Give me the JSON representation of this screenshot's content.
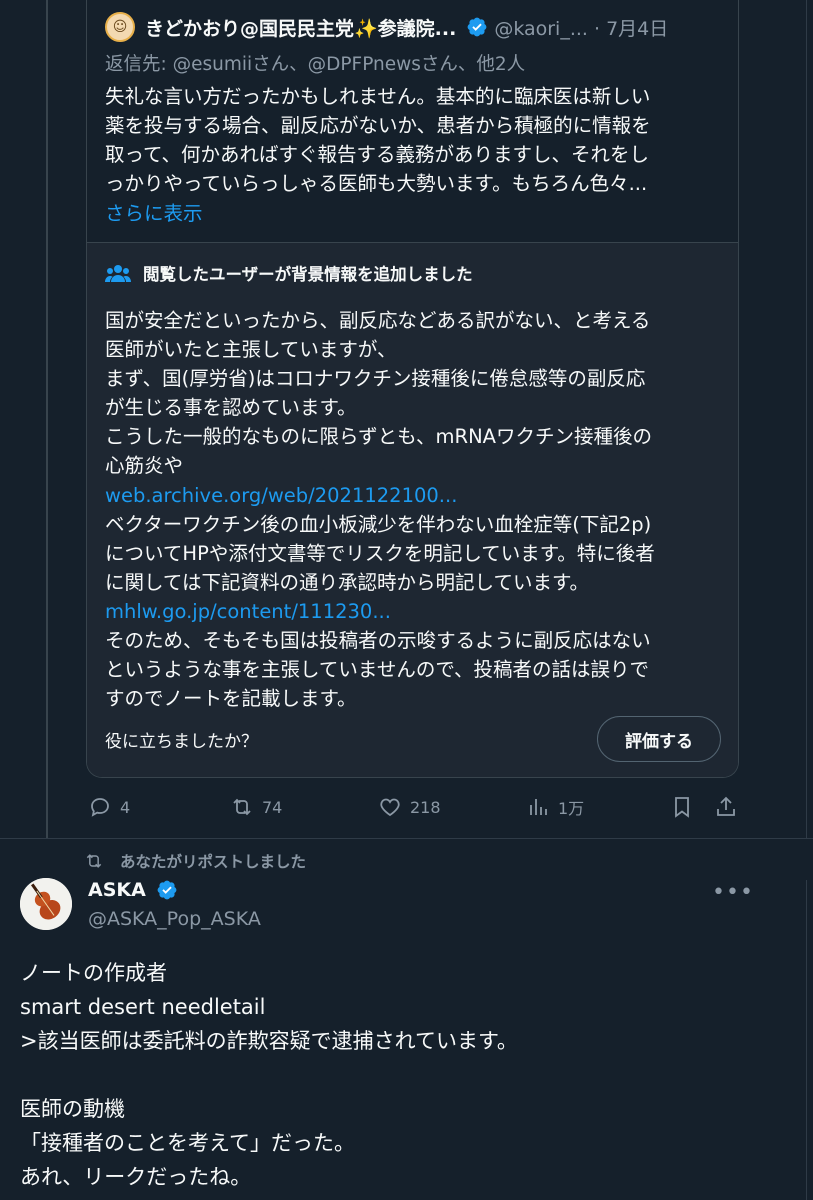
{
  "quoted_post": {
    "author_name": "きどかおり@国民民主党✨参議院...",
    "author_handle": "@kaori_... · 7月4日",
    "reply_to": "返信先: @esumiiさん、@DPFPnewsさん、他2人",
    "body": "失礼な言い方だったかもしれません。基本的に臨床医は新しい\n薬を投与する場合、副反応がないか、患者から積極的に情報を\n取って、何かあればすぐ報告する義務がありますし、それをし\nっかりやっていらっしゃる医師も大勢います。もちろん色々...",
    "show_more": "さらに表示"
  },
  "community_note": {
    "title": "閲覧したユーザーが背景情報を追加しました",
    "lines": [
      {
        "type": "text",
        "text": "国が安全だといったから、副反応などある訳がない、と考える\n医師がいたと主張していますが、\nまず、国(厚労省)はコロナワクチン接種後に倦怠感等の副反応\nが生じる事を認めています。\nこうした一般的なものに限らずとも、mRNAワクチン接種後の\n心筋炎や"
      },
      {
        "type": "link",
        "text": "web.archive.org/web/2021122100..."
      },
      {
        "type": "text",
        "text": "ベクターワクチン後の血小板減少を伴わない血栓症等(下記2p)\nについてHPや添付文書等でリスクを明記しています。特に後者\nに関しては下記資料の通り承認時から明記しています。"
      },
      {
        "type": "link",
        "text": "mhlw.go.jp/content/111230..."
      },
      {
        "type": "text",
        "text": "そのため、そもそも国は投稿者の示唆するように副反応はない\nというような事を主張していませんので、投稿者の話は誤りで\nすのでノートを記載します。"
      }
    ],
    "helpful_prompt": "役に立ちましたか？",
    "rate_label": "評価する"
  },
  "actions": {
    "replies": "4",
    "reposts": "74",
    "likes": "218",
    "views": "1万"
  },
  "repost_banner": "あなたがリポストしました",
  "post": {
    "author_name": "ASKA",
    "author_handle": "@ASKA_Pop_ASKA",
    "body": "ノートの作成者\nsmart desert needletail\n>該当医師は委託料の詐欺容疑で逮捕されています。\n\n医師の動機\n「接種者のことを考えて」だった。\nあれ、リークだったね。"
  },
  "colors": {
    "background": "#15202b",
    "note_background": "#1e2732",
    "accent": "#1d9bf0",
    "muted": "#8b98a5"
  }
}
